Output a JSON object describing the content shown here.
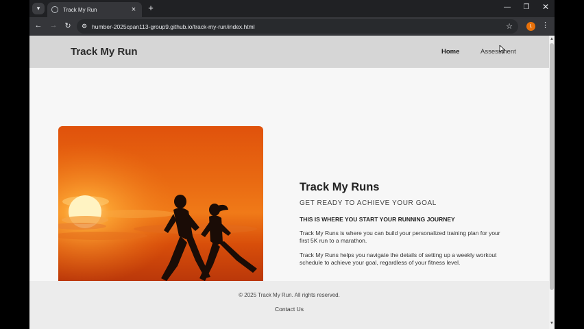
{
  "browser": {
    "tab_title": "Track My Run",
    "new_tab_glyph": "+",
    "url": "humber-2025cpan113-group9.github.io/track-my-run/index.html",
    "profile_initial": "L",
    "icons": [
      "tab-search-icon",
      "favicon-icon",
      "tab-close-icon",
      "new-tab-icon",
      "minimize-icon",
      "restore-icon",
      "window-close-icon",
      "back-icon",
      "forward-icon",
      "reload-icon",
      "site-info-icon",
      "bookmark-star-icon",
      "menu-icon"
    ]
  },
  "site": {
    "logo": "Track My Run",
    "nav": {
      "home": "Home",
      "assessment": "Assessment"
    }
  },
  "hero": {
    "title": "Track My Runs",
    "subtitle": "GET READY TO ACHIEVE YOUR GOAL",
    "tagline": "THIS IS WHERE YOU START YOUR RUNNING JOURNEY",
    "paragraph1": "Track My Runs is where you can build your personalized training plan for your first 5K run to a marathon.",
    "paragraph2": "Track My Runs helps you navigate the details of setting up a weekly workout schedule to achieve your goal, regardless of your fitness level."
  },
  "footer": {
    "copyright": "© 2025 Track My Run. All rights reserved.",
    "contact": "Contact Us"
  },
  "colors": {
    "header_bg": "#d6d6d6",
    "page_bg": "#f7f7f7",
    "footer_bg": "#ececec",
    "sunset_orange": "#e0520c",
    "profile_orange": "#e8710a"
  }
}
